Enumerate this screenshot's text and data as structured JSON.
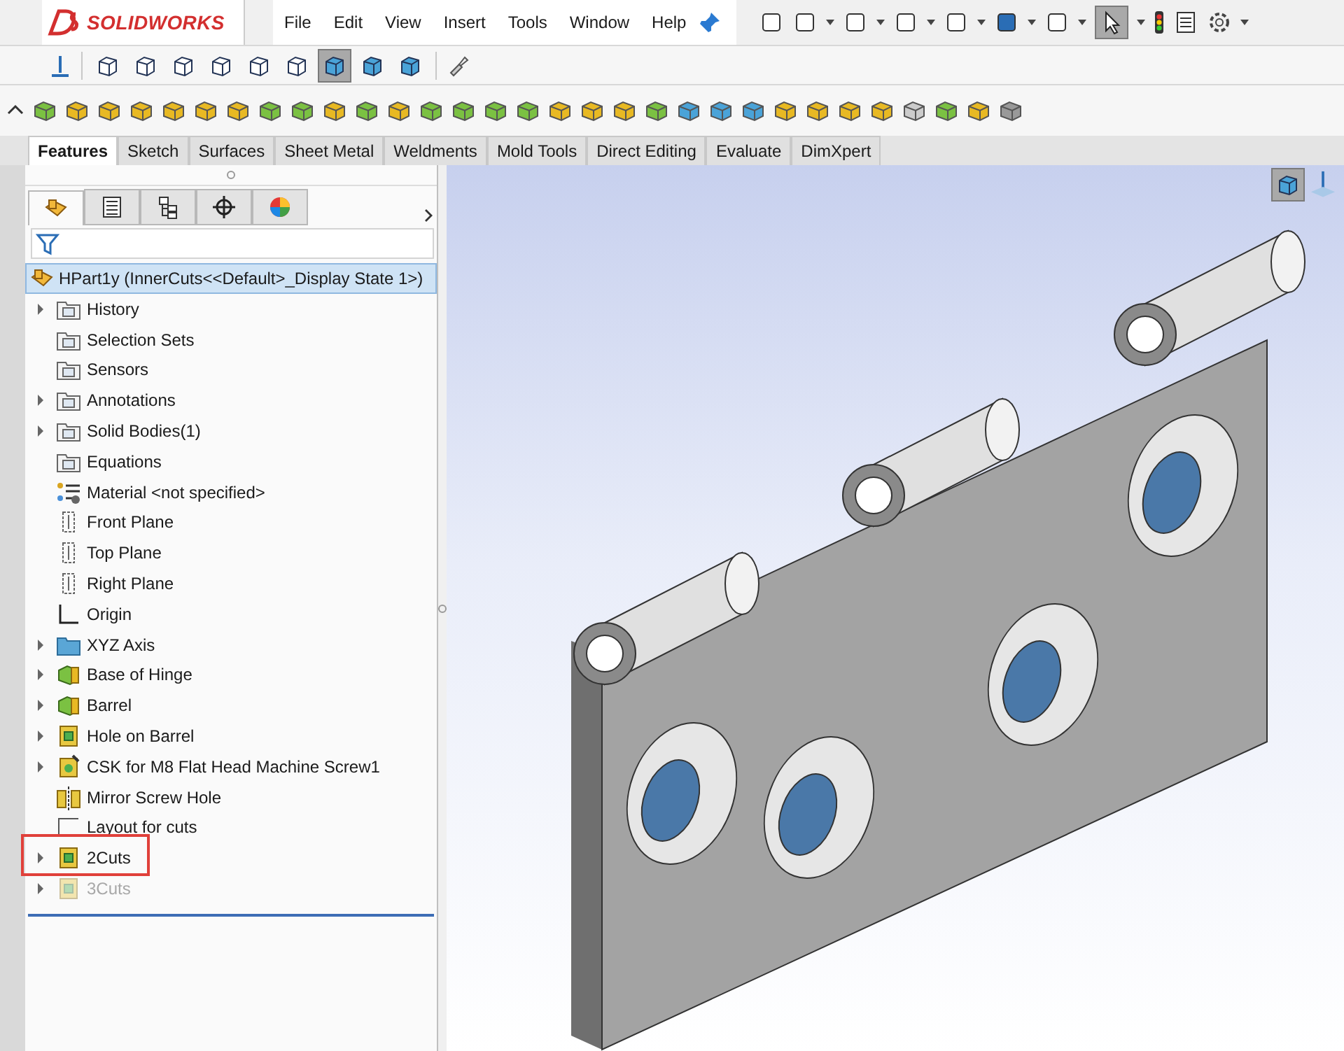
{
  "app": {
    "logo": "SOLIDWORKS",
    "menu": [
      "File",
      "Edit",
      "View",
      "Insert",
      "Tools",
      "Window",
      "Help"
    ]
  },
  "view_modes": [
    {
      "selected": false
    },
    {
      "selected": false
    },
    {
      "selected": false
    },
    {
      "selected": false
    },
    {
      "selected": false
    },
    {
      "selected": false
    },
    {
      "selected": true
    },
    {
      "selected": false
    },
    {
      "selected": false
    }
  ],
  "command_tabs": [
    {
      "label": "Features",
      "selected": true
    },
    {
      "label": "Sketch",
      "selected": false
    },
    {
      "label": "Surfaces",
      "selected": false
    },
    {
      "label": "Sheet Metal",
      "selected": false
    },
    {
      "label": "Weldments",
      "selected": false
    },
    {
      "label": "Mold Tools",
      "selected": false
    },
    {
      "label": "Direct Editing",
      "selected": false
    },
    {
      "label": "Evaluate",
      "selected": false
    },
    {
      "label": "DimXpert",
      "selected": false
    }
  ],
  "panel_tabs": [
    {
      "selected": true
    },
    {
      "selected": false
    },
    {
      "selected": false
    },
    {
      "selected": false
    },
    {
      "selected": false
    }
  ],
  "feature_tree": {
    "root": "HPart1y  (InnerCuts<<Default>_Display State 1>)",
    "items": [
      {
        "label": "History",
        "kind": "history",
        "expandable": true,
        "highlighted": false,
        "suppressed": false
      },
      {
        "label": "Selection Sets",
        "kind": "selection",
        "expandable": false,
        "highlighted": false,
        "suppressed": false
      },
      {
        "label": "Sensors",
        "kind": "sensors",
        "expandable": false,
        "highlighted": false,
        "suppressed": false
      },
      {
        "label": "Annotations",
        "kind": "annotations",
        "expandable": true,
        "highlighted": false,
        "suppressed": false
      },
      {
        "label": "Solid Bodies(1)",
        "kind": "bodies",
        "expandable": true,
        "highlighted": false,
        "suppressed": false
      },
      {
        "label": "Equations",
        "kind": "equations",
        "expandable": false,
        "highlighted": false,
        "suppressed": false
      },
      {
        "label": "Material <not specified>",
        "kind": "material",
        "expandable": false,
        "highlighted": false,
        "suppressed": false
      },
      {
        "label": "Front Plane",
        "kind": "plane",
        "expandable": false,
        "highlighted": false,
        "suppressed": false
      },
      {
        "label": "Top Plane",
        "kind": "plane",
        "expandable": false,
        "highlighted": false,
        "suppressed": false
      },
      {
        "label": "Right Plane",
        "kind": "plane",
        "expandable": false,
        "highlighted": false,
        "suppressed": false
      },
      {
        "label": "Origin",
        "kind": "origin",
        "expandable": false,
        "highlighted": false,
        "suppressed": false
      },
      {
        "label": "XYZ Axis",
        "kind": "folder",
        "expandable": true,
        "highlighted": false,
        "suppressed": false
      },
      {
        "label": "Base of Hinge",
        "kind": "extrude",
        "expandable": true,
        "highlighted": false,
        "suppressed": false
      },
      {
        "label": "Barrel",
        "kind": "extrude",
        "expandable": true,
        "highlighted": false,
        "suppressed": false
      },
      {
        "label": "Hole on Barrel",
        "kind": "cut",
        "expandable": true,
        "highlighted": false,
        "suppressed": false
      },
      {
        "label": "CSK for M8 Flat Head Machine Screw1",
        "kind": "hole",
        "expandable": true,
        "highlighted": false,
        "suppressed": false
      },
      {
        "label": "Mirror Screw Hole",
        "kind": "mirror",
        "expandable": false,
        "highlighted": false,
        "suppressed": false
      },
      {
        "label": "Layout for cuts",
        "kind": "sketch",
        "expandable": false,
        "highlighted": false,
        "suppressed": false
      },
      {
        "label": "2Cuts",
        "kind": "cut",
        "expandable": true,
        "highlighted": true,
        "suppressed": false
      },
      {
        "label": "3Cuts",
        "kind": "cut",
        "expandable": true,
        "highlighted": false,
        "suppressed": true
      }
    ]
  }
}
